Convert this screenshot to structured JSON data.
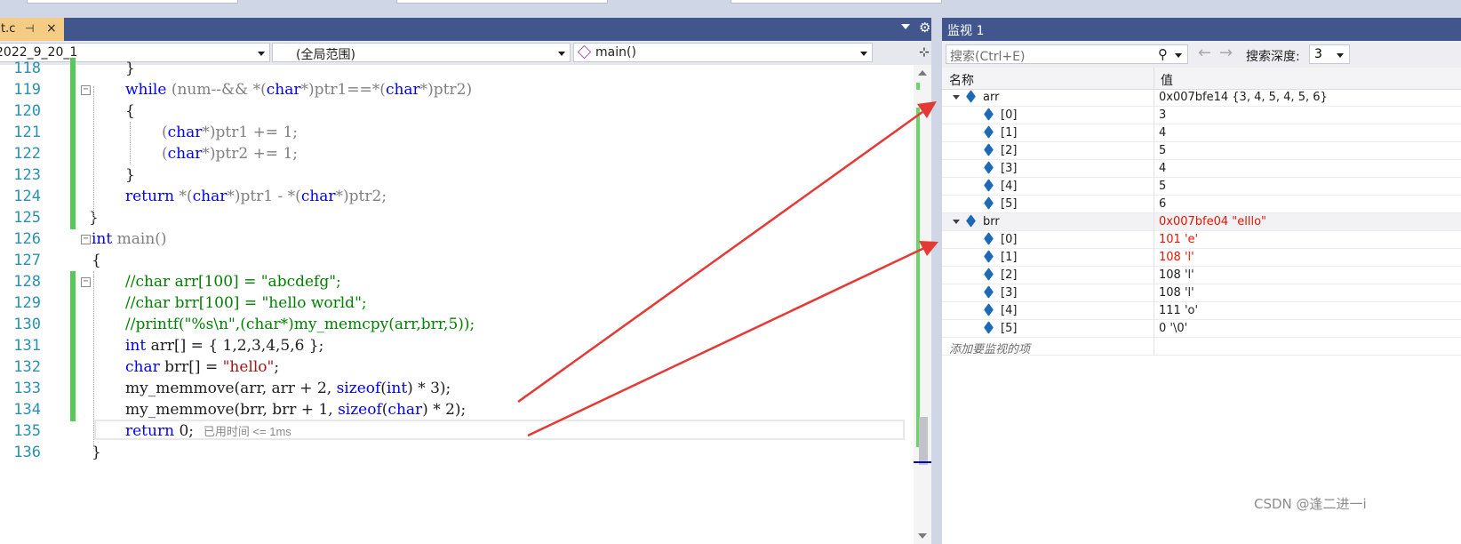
{
  "editor": {
    "file_tab": {
      "name": "t.c",
      "pin_glyph": "⊣",
      "close_glyph": "×"
    },
    "nav": {
      "project": "2022_9_20_1",
      "scope": "(全局范围)",
      "function": "main()"
    },
    "lines": [
      {
        "num": "118"
      },
      {
        "num": "119"
      },
      {
        "num": "120"
      },
      {
        "num": "121"
      },
      {
        "num": "122"
      },
      {
        "num": "123"
      },
      {
        "num": "124"
      },
      {
        "num": "125"
      },
      {
        "num": "126"
      },
      {
        "num": "127"
      },
      {
        "num": "128"
      },
      {
        "num": "129"
      },
      {
        "num": "130"
      },
      {
        "num": "131"
      },
      {
        "num": "132"
      },
      {
        "num": "133"
      },
      {
        "num": "134"
      },
      {
        "num": "135"
      },
      {
        "num": "136"
      }
    ],
    "code": {
      "l118": "}",
      "l119_kw": "while",
      "l119_a": " (num--&& *(",
      "l119_t1": "char",
      "l119_b": "*)ptr1==*(",
      "l119_t2": "char",
      "l119_c": "*)ptr2)",
      "l120": "{",
      "l121_a": "(",
      "l121_t": "char",
      "l121_b": "*)ptr1 += 1;",
      "l122_a": "(",
      "l122_t": "char",
      "l122_b": "*)ptr2 += 1;",
      "l123": "}",
      "l124_kw": "return",
      "l124_a": " *(",
      "l124_t1": "char",
      "l124_b": "*)ptr1 - *(",
      "l124_t2": "char",
      "l124_c": "*)ptr2;",
      "l125": "}",
      "l126_kw": "int",
      "l126_a": " main()",
      "l127": "{",
      "l128": "//char arr[100] = \"abcdefg\";",
      "l129": "//char brr[100] = \"hello world\";",
      "l130": "//printf(\"%s\\n\",(char*)my_memcpy(arr,brr,5));",
      "l131_kw": "int",
      "l131_a": " arr[] = { 1,2,3,4,5,6 };",
      "l132_kw": "char",
      "l132_a": " brr[] = ",
      "l132_s": "\"hello\"",
      "l132_b": ";",
      "l133_a": "my_memmove(arr, arr + 2, ",
      "l133_kw": "sizeof",
      "l133_b": "(",
      "l133_t": "int",
      "l133_c": ") * 3);",
      "l134_a": "my_memmove(brr, brr + 1, ",
      "l134_kw": "sizeof",
      "l134_b": "(",
      "l134_t": "char",
      "l134_c": ") * 2);",
      "l135_kw": "return",
      "l135_a": " 0;",
      "l135_elapsed": "已用时间 <= 1ms",
      "l136": "}"
    }
  },
  "watch": {
    "title": "监视 1",
    "search_placeholder": "搜索(Ctrl+E)",
    "depth_label": "搜索深度:",
    "depth_value": "3",
    "col_name": "名称",
    "col_value": "值",
    "rows": [
      {
        "name": "arr",
        "value": "0x007bfe14 {3, 4, 5, 4, 5, 6}"
      },
      {
        "name": "[0]",
        "value": "3"
      },
      {
        "name": "[1]",
        "value": "4"
      },
      {
        "name": "[2]",
        "value": "5"
      },
      {
        "name": "[3]",
        "value": "4"
      },
      {
        "name": "[4]",
        "value": "5"
      },
      {
        "name": "[5]",
        "value": "6"
      },
      {
        "name": "brr",
        "value": "0x007bfe04 \"elllo\""
      },
      {
        "name": "[0]",
        "value": "101 'e'"
      },
      {
        "name": "[1]",
        "value": "108 'l'"
      },
      {
        "name": "[2]",
        "value": "108 'l'"
      },
      {
        "name": "[3]",
        "value": "108 'l'"
      },
      {
        "name": "[4]",
        "value": "111 'o'"
      },
      {
        "name": "[5]",
        "value": "0 '\\0'"
      }
    ],
    "add_item": "添加要监视的项",
    "changed_color": "#e51400"
  },
  "watermark": "CSDN @逢二进一i",
  "annotation_color": "#e53935"
}
